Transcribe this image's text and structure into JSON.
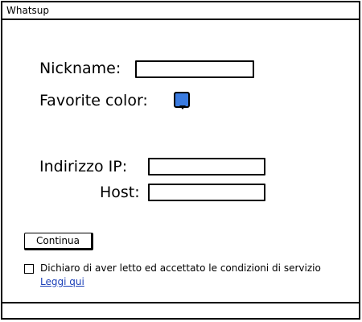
{
  "window": {
    "title": "Whatsup"
  },
  "form": {
    "nickname_label": "Nickname:",
    "nickname_value": "",
    "favorite_color_label": "Favorite color:",
    "favorite_color_value": "#3a7be0",
    "ip_label": "Indirizzo IP:",
    "ip_value": "",
    "host_label": "Host:",
    "host_value": ""
  },
  "actions": {
    "continue_label": "Continua"
  },
  "terms": {
    "checked": false,
    "text": "Dichiaro di aver letto ed accettato le condizioni di servizio",
    "link_label": "Leggi qui"
  }
}
